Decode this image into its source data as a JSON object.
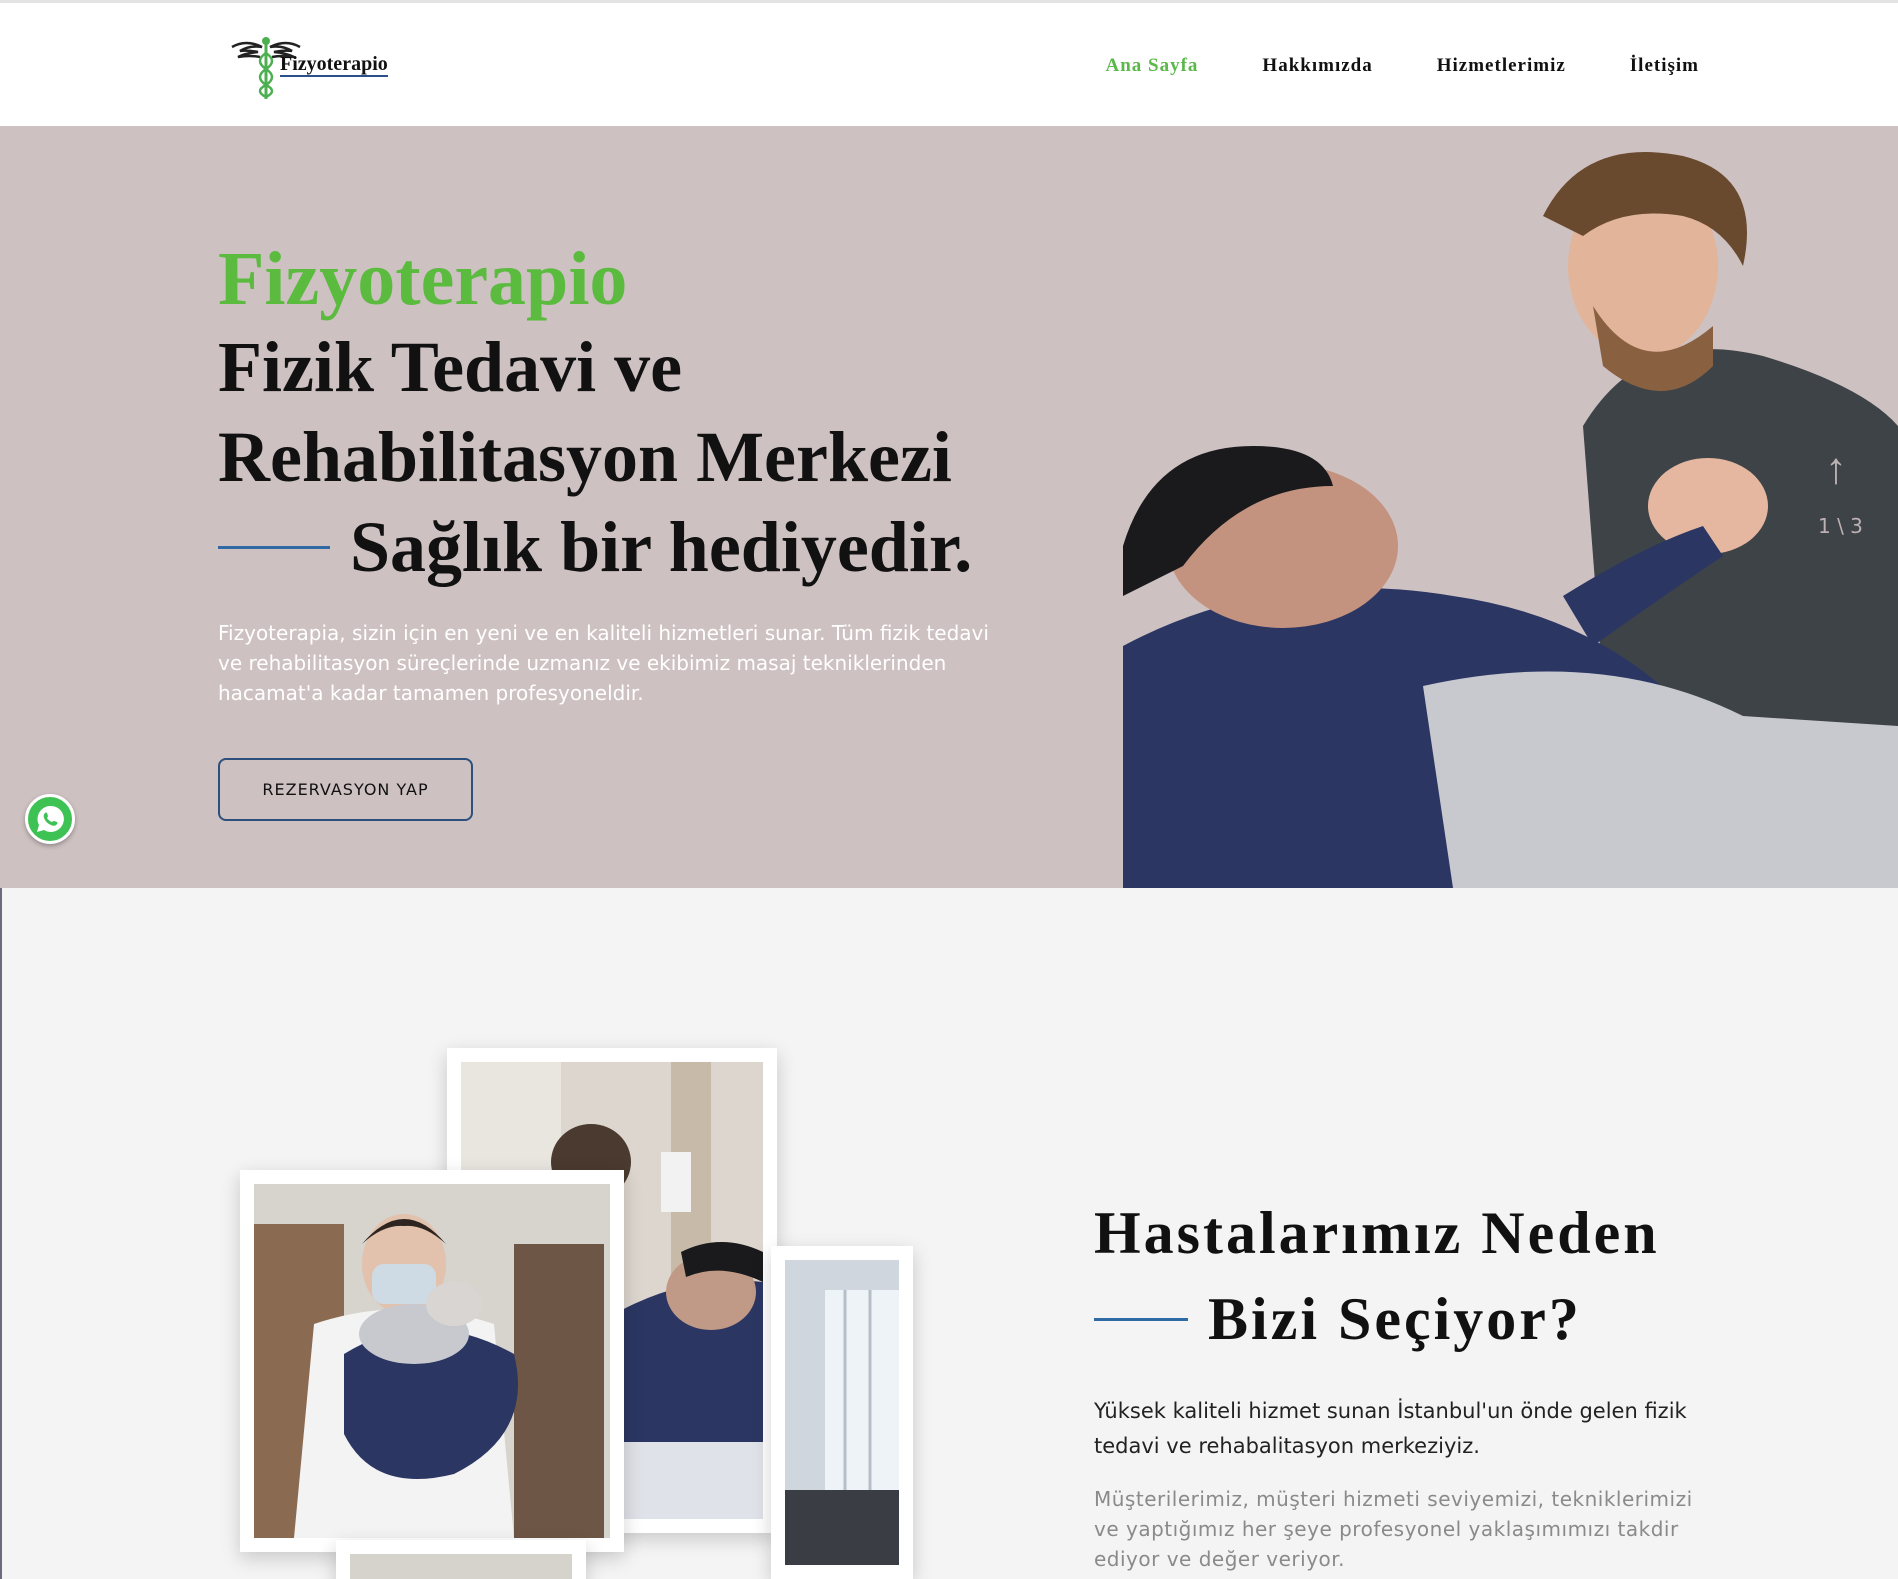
{
  "header": {
    "logo_text": "Fizyoterapio",
    "nav": [
      {
        "label": "Ana Sayfa",
        "active": true
      },
      {
        "label": "Hakkımızda",
        "active": false
      },
      {
        "label": "Hizmetlerimiz",
        "active": false
      },
      {
        "label": "İletişim",
        "active": false
      }
    ]
  },
  "hero": {
    "brand": "Fizyoterapio",
    "heading_line1": "Fizik Tedavi ve",
    "heading_line2": "Rehabilitasyon Merkezi",
    "heading_line3": "Sağlık bir hediyedir.",
    "description": "Fizyoterapia, sizin için en yeni ve en kaliteli hizmetleri sunar. Tüm fizik tedavi ve rehabilitasyon süreçlerinde uzmanız ve ekibimiz masaj tekniklerinden hacamat'a kadar tamamen profesyoneldir.",
    "button_label": "REZERVASYON YAP",
    "slide_counter": "1 \\ 3",
    "icons": {
      "scroll": "arrow-up-icon",
      "whatsapp": "whatsapp-icon"
    }
  },
  "why": {
    "title_line1": "Hastalarımız Neden",
    "title_line2": "Bizi Seçiyor?",
    "lead": "Yüksek kaliteli hizmet sunan İstanbul'un önde gelen fizik tedavi ve rehabalitasyon merkeziyiz.",
    "body": "Müşterilerimiz, müşteri hizmeti seviyemizi, tekniklerimizi ve yaptığımız her şeye profesyonel yaklaşımımızı takdir ediyor ve değer veriyor."
  },
  "colors": {
    "accent_green": "#5bbb3f",
    "accent_blue": "#2f6aa5",
    "hero_bg": "#cec1c2",
    "whatsapp_green": "#3fc254"
  }
}
